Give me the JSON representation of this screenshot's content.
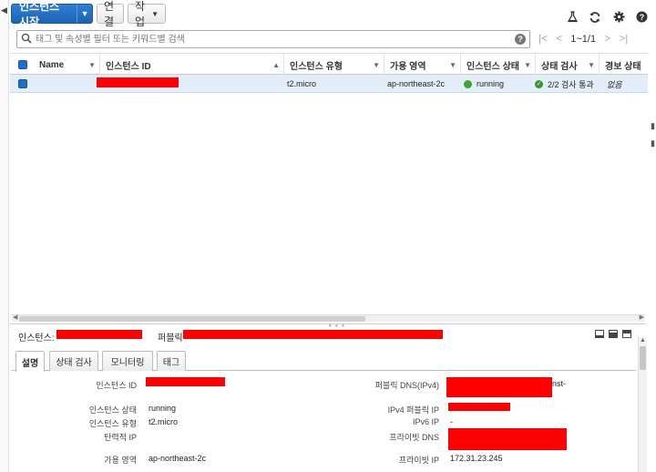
{
  "toolbar": {
    "launch_label": "인스턴스 시작",
    "connect_label": "연결",
    "actions_label": "작업"
  },
  "filter": {
    "placeholder": "태그 및 속성별 필터 또는 키워드별 검색",
    "help": "?"
  },
  "pager": {
    "range": "1~1/1"
  },
  "table": {
    "headers": [
      "Name",
      "인스턴스 ID",
      "인스턴스 유형",
      "가용 영역",
      "인스턴스 상태",
      "상태 검사",
      "경보 상태"
    ],
    "row": {
      "name": "",
      "instance_type": "t2.micro",
      "zone": "ap-northeast-2c",
      "state": "running",
      "checks": "2/2 검사 통과",
      "alarm": "없음"
    }
  },
  "detail": {
    "instance_label": "인스턴스:",
    "public_label": "퍼블릭",
    "tabs": [
      "설명",
      "상태 검사",
      "모니터링",
      "태그"
    ],
    "fields": {
      "instance_id_label": "인스턴스 ID",
      "instance_state_label": "인스턴스 상태",
      "instance_state": "running",
      "instance_type_label": "인스턴스 유형",
      "instance_type": "t2.micro",
      "elastic_ip_label": "탄력적 IP",
      "zone_label": "가용 영역",
      "zone": "ap-northeast-2c",
      "public_dns_label": "퍼블릭 DNS(IPv4)",
      "public_dns_suffix": "nst-",
      "public_ip_label": "IPv4 퍼블릭 IP",
      "ipv6_label": "IPv6 IP",
      "ipv6": "-",
      "private_dns_label": "프라이빗 DNS",
      "private_ip_label": "프라이빗 IP",
      "private_ip": "172.31.23.245"
    }
  },
  "colors": {
    "primary": "#1f6fc6",
    "selected_row": "#e4eef9",
    "running": "#3fa52f",
    "redaction": "#ff0000"
  }
}
